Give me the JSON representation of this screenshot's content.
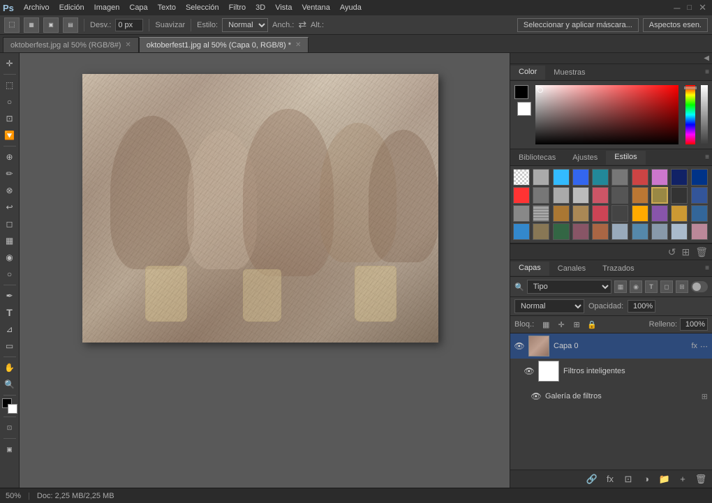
{
  "app": {
    "name": "Adobe Photoshop",
    "logo": "Ps"
  },
  "menu": {
    "items": [
      "Archivo",
      "Edición",
      "Imagen",
      "Capa",
      "Texto",
      "Selección",
      "Filtro",
      "3D",
      "Vista",
      "Ventana",
      "Ayuda"
    ]
  },
  "options_bar": {
    "desvio_label": "Desv.:",
    "desvio_value": "0 px",
    "suavizar_label": "Suavizar",
    "estilo_label": "Estilo:",
    "estilo_value": "Normal",
    "ancho_label": "Anch.:",
    "alto_label": "Alt.:",
    "select_mask_btn": "Seleccionar y aplicar máscara...",
    "aspectos_btn": "Aspectos esen."
  },
  "tabs": [
    {
      "id": "tab1",
      "label": "oktoberfest.jpg al 50% (RGB/8#)",
      "active": false,
      "modified": false
    },
    {
      "id": "tab2",
      "label": "oktoberfest1.jpg al 50% (Capa 0, RGB/8) *",
      "active": true,
      "modified": true
    }
  ],
  "color_panel": {
    "tabs": [
      "Color",
      "Muestras"
    ],
    "active_tab": "Color"
  },
  "styles_panel": {
    "tabs": [
      "Bibliotecas",
      "Ajustes",
      "Estilos"
    ],
    "active_tab": "Estilos",
    "swatches": [
      {
        "bg": "#ffffff",
        "border": "2px solid transparent",
        "has_x": true
      },
      {
        "bg": "#cccccc"
      },
      {
        "bg": "#44ccff"
      },
      {
        "bg": "#4488ff"
      },
      {
        "bg": "#44aacc"
      },
      {
        "bg": "#888888"
      },
      {
        "bg": "#cc4444"
      },
      {
        "bg": "#cc88cc"
      },
      {
        "bg": "#224488"
      },
      {
        "bg": "#004499"
      },
      {
        "bg": "#ff4444"
      },
      {
        "bg": "#888888"
      },
      {
        "bg": "#aaaaaa"
      },
      {
        "bg": "#bbbbbb"
      },
      {
        "bg": "#cc6677"
      },
      {
        "bg": "#666666"
      },
      {
        "bg": "#cc8844"
      },
      {
        "bg": "#aa8855"
      },
      {
        "bg": "#bb6644"
      },
      {
        "bg": "#ff8800"
      },
      {
        "bg": "#999999"
      },
      {
        "bg": "#aaaaaa"
      },
      {
        "bg": "#ee5566"
      },
      {
        "bg": "#886644"
      },
      {
        "bg": "#ffcc00"
      },
      {
        "bg": "#4488ff"
      },
      {
        "bg": "#66aacc"
      },
      {
        "bg": "#6644aa"
      },
      {
        "bg": "#ccaa44"
      },
      {
        "bg": "#4466bb"
      },
      {
        "bg": "#4488cc"
      },
      {
        "bg": "#887766"
      },
      {
        "bg": "#446655"
      },
      {
        "bg": "#886677"
      },
      {
        "bg": "#aa7755"
      },
      {
        "bg": "#88aabb"
      },
      {
        "bg": "#6699bb"
      },
      {
        "bg": "#99aabb"
      },
      {
        "bg": "#bbccdd"
      },
      {
        "bg": "#cc99aa"
      }
    ]
  },
  "layers_panel": {
    "tabs": [
      "Capas",
      "Canales",
      "Trazados"
    ],
    "active_tab": "Capas",
    "filter_type": "Tipo",
    "blend_mode": "Normal",
    "opacity_label": "Opacidad:",
    "opacity_value": "100%",
    "lock_label": "Bloq.:",
    "fill_label": "Relleno:",
    "fill_value": "100%",
    "layers": [
      {
        "id": "layer-capa0",
        "name": "Capa 0",
        "visible": true,
        "active": true,
        "has_fx": true,
        "has_mask": false
      },
      {
        "id": "layer-smart-filters",
        "name": "Filtros inteligentes",
        "visible": true,
        "active": false,
        "indent": true,
        "is_smart_filter": true
      },
      {
        "id": "layer-gallery",
        "name": "Galería de filtros",
        "visible": true,
        "active": false,
        "indent": true,
        "is_filter_item": true
      }
    ]
  },
  "status_bar": {
    "zoom": "50%",
    "doc_info": "Doc: 2,25 MB/2,25 MB"
  }
}
